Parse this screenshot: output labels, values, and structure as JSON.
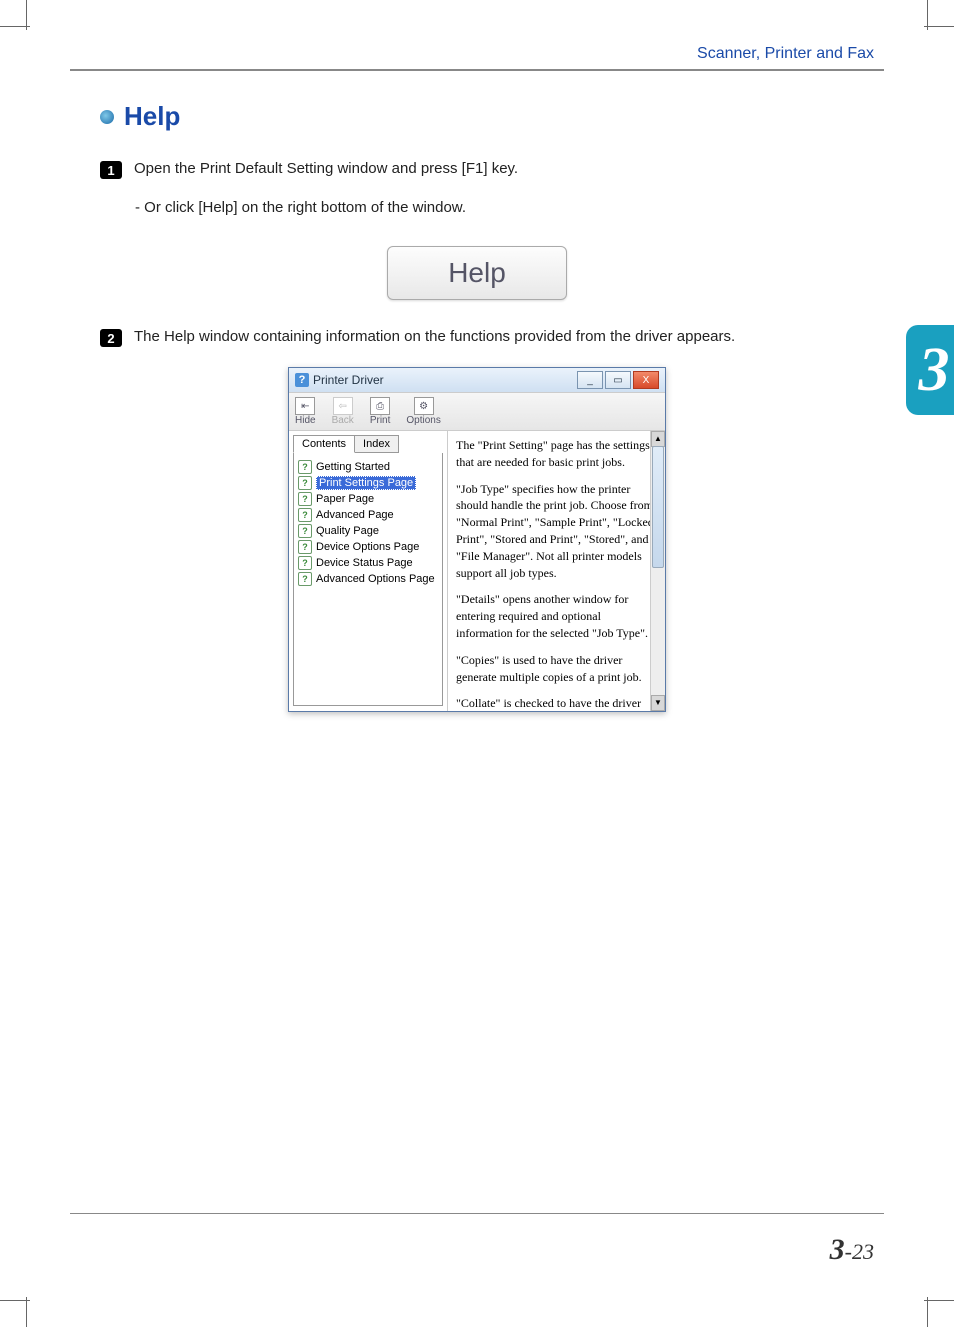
{
  "header": {
    "section_title": "Scanner, Printer and Fax"
  },
  "side_tab": {
    "number": "3"
  },
  "heading": {
    "text": "Help"
  },
  "steps": {
    "s1": {
      "num": "1",
      "text": "Open the Print Default Setting window and press [F1] key.",
      "sub": "- Or click [Help] on the right bottom of the window."
    },
    "s2": {
      "num": "2",
      "text": "The Help window containing information on the functions provided from the driver appears."
    }
  },
  "help_button": {
    "label": "Help"
  },
  "help_window": {
    "title": "Printer Driver",
    "toolbar": {
      "hide": "Hide",
      "back": "Back",
      "print": "Print",
      "options": "Options"
    },
    "tabs": {
      "contents": "Contents",
      "index": "Index"
    },
    "tree": {
      "t0": "Getting Started",
      "t1": "Print Settings Page",
      "t2": "Paper Page",
      "t3": "Advanced Page",
      "t4": "Quality Page",
      "t5": "Device Options Page",
      "t6": "Device Status Page",
      "t7": "Advanced Options Page"
    },
    "content": {
      "p1": "The \"Print Setting\" page has the settings that are needed for basic print jobs.",
      "p2": "\"Job Type\" specifies how the printer should handle the print job. Choose from \"Normal Print\", \"Sample Print\", \"Locked Print\", \"Stored and Print\", \"Stored\", and \"File Manager\". Not all printer models support all job types.",
      "p3": "\"Details\" opens another window for entering required and optional information for the selected \"Job Type\".",
      "p4": "\"Copies\" is used to have the driver generate multiple copies of a print job.",
      "p5": "\"Collate\" is checked to have the driver generate collated copies. Normally, if"
    }
  },
  "footer": {
    "page_chapter": "3",
    "page_sep": "-",
    "page_num": "23"
  }
}
